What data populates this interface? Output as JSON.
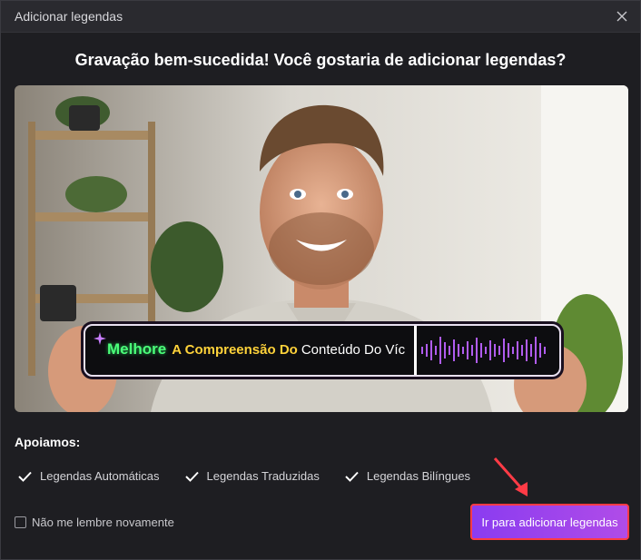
{
  "window": {
    "title": "Adicionar legendas"
  },
  "heading": "Gravação bem-sucedida! Você gostaria de adicionar legendas?",
  "preview": {
    "caption": {
      "word1": "Melhore",
      "word2": "A Compreensão Do",
      "word3": "Conteúdo Do Víc"
    },
    "colors": {
      "word1": "#4cff7a",
      "word2": "#ffd23a",
      "word3": "#ffffff",
      "wave": "#b05cf0"
    }
  },
  "support": {
    "title": "Apoiamos:",
    "items": [
      "Legendas Automáticas",
      "Legendas Traduzidas",
      "Legendas Bilíngues"
    ]
  },
  "remember_label": "Não me lembre novamente",
  "cta_label": "Ir para adicionar legendas",
  "colors": {
    "accent": "#8a3cf0",
    "highlight": "#ff3b46"
  }
}
